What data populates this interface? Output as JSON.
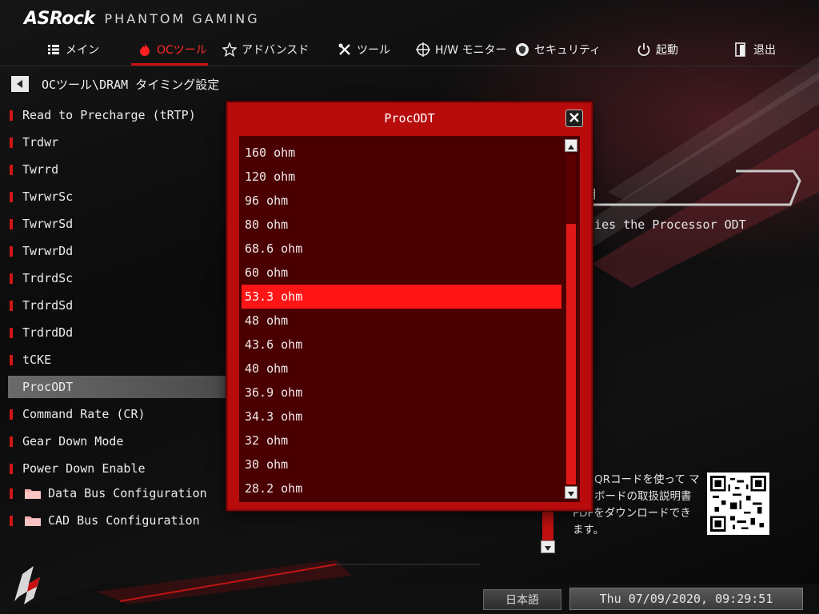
{
  "brand": {
    "logo": "ASRock",
    "subtitle": "PHANTOM GAMING"
  },
  "nav": {
    "items": [
      {
        "label": "メイン",
        "icon": "list-icon",
        "active": false
      },
      {
        "label": "OCツール",
        "icon": "flame-icon",
        "active": true
      },
      {
        "label": "アドバンスド",
        "icon": "star-icon",
        "active": false
      },
      {
        "label": "ツール",
        "icon": "tools-icon",
        "active": false
      },
      {
        "label": "H/W モニター",
        "icon": "crosshair-icon",
        "active": false
      },
      {
        "label": "セキュリティ",
        "icon": "shield-icon",
        "active": false
      },
      {
        "label": "起動",
        "icon": "power-icon",
        "active": false
      },
      {
        "label": "退出",
        "icon": "exit-icon",
        "active": false
      }
    ]
  },
  "breadcrumb": {
    "text": "OCツール\\DRAM タイミング設定"
  },
  "settings": {
    "items": [
      {
        "label": "Read to Precharge (tRTP)"
      },
      {
        "label": "Trdwr"
      },
      {
        "label": "Twrrd"
      },
      {
        "label": "TwrwrSc"
      },
      {
        "label": "TwrwrSd"
      },
      {
        "label": "TwrwrDd"
      },
      {
        "label": "TrdrdSc"
      },
      {
        "label": "TrdrdSd"
      },
      {
        "label": "TrdrdDd"
      },
      {
        "label": "tCKE"
      },
      {
        "label": "ProcODT",
        "selected": true
      },
      {
        "label": "Command Rate (CR)"
      },
      {
        "label": "Gear Down Mode"
      },
      {
        "label": "Power Down Enable"
      }
    ],
    "folders": [
      {
        "label": "Data Bus Configuration"
      },
      {
        "label": "CAD Bus Configuration"
      }
    ]
  },
  "help": {
    "title_visible": "明",
    "text_visible": "cifies the Processor ODT"
  },
  "qr": {
    "text_visible": "このQRコードを使って マザーボードの取扱説明書PDFをダウンロードできます。"
  },
  "footer": {
    "language": "日本語",
    "datetime": "Thu 07/09/2020, 09:29:51"
  },
  "dialog": {
    "title": "ProcODT",
    "options": [
      "160 ohm",
      "120 ohm",
      "96 ohm",
      "80 ohm",
      "68.6 ohm",
      "60 ohm",
      "53.3 ohm",
      "48 ohm",
      "43.6 ohm",
      "40 ohm",
      "36.9 ohm",
      "34.3 ohm",
      "32 ohm",
      "30 ohm",
      "28.2 ohm"
    ],
    "selected": "53.3 ohm"
  },
  "colors": {
    "accent": "#d01010",
    "highlight": "#ff1515",
    "dialog_bg": "#b80c0c",
    "list_bg": "#4a0000"
  }
}
